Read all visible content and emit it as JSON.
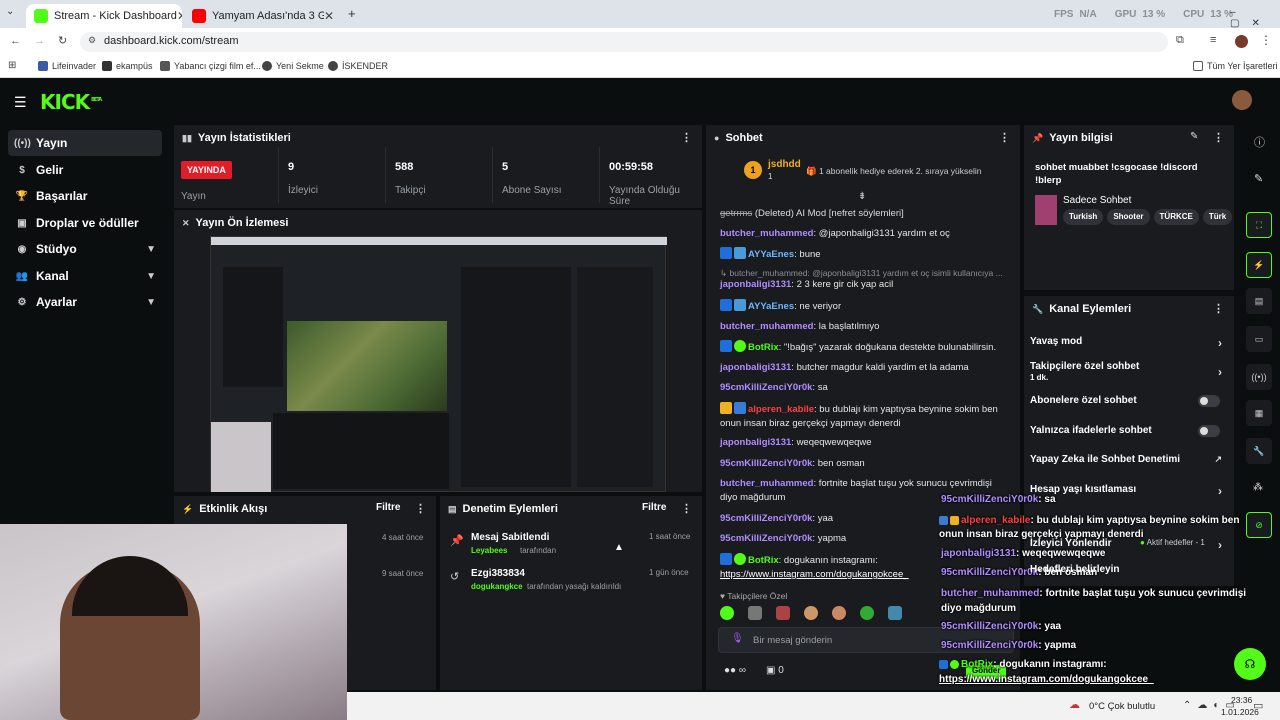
{
  "browser": {
    "tabs": [
      {
        "title": "Stream - Kick Dashboard",
        "active": true
      },
      {
        "title": "Yamyam Adası'nda 3 Günlük Ha",
        "active": false
      }
    ],
    "url": "dashboard.kick.com/stream",
    "perf": {
      "fps_label": "FPS",
      "fps_value": "N/A",
      "gpu_label": "GPU",
      "gpu_value": "13 %",
      "cpu_label": "CPU",
      "cpu_value": "13 %"
    },
    "bookmarks": [
      "Lifeinvader",
      "ekampüs",
      "Yabancı çizgi film ef...",
      "Yeni Sekme",
      "İSKENDER"
    ],
    "all_bookmarks": "Tüm Yer İşaretleri"
  },
  "brand": {
    "logo": "KICK",
    "beta": "BETA"
  },
  "sidebar": {
    "items": [
      {
        "label": "Yayın",
        "icon": "broadcast-icon",
        "active": true
      },
      {
        "label": "Gelir",
        "icon": "dollar-icon"
      },
      {
        "label": "Başarılar",
        "icon": "trophy-icon"
      },
      {
        "label": "Droplar ve ödüller",
        "icon": "gift-icon"
      },
      {
        "label": "Stüdyo",
        "icon": "studio-icon",
        "expandable": true
      },
      {
        "label": "Kanal",
        "icon": "people-icon",
        "expandable": true
      },
      {
        "label": "Ayarlar",
        "icon": "gear-icon",
        "expandable": true
      }
    ]
  },
  "stats": {
    "title": "Yayın İstatistikleri",
    "live_badge": "YAYINDA",
    "live_label": "Yayın",
    "items": [
      {
        "value": "9",
        "label": "İzleyici"
      },
      {
        "value": "588",
        "label": "Takipçi"
      },
      {
        "value": "5",
        "label": "Abone Sayısı"
      },
      {
        "value": "00:59:58",
        "label": "Yayında Olduğu Süre"
      }
    ]
  },
  "preview": {
    "title": "Yayın Ön İzlemesi"
  },
  "activity": {
    "title": "Etkinlik Akışı",
    "filter": "Filtre",
    "times": [
      "4 saat önce",
      "9 saat önce"
    ]
  },
  "moderation": {
    "title": "Denetim Eylemleri",
    "filter": "Filtre",
    "entries": [
      {
        "title": "Mesaj Sabitlendi",
        "actor": "Leyabees",
        "suffix": "tarafından",
        "time": "1 saat önce"
      },
      {
        "title": "Ezgi383834",
        "actor": "dogukangkce",
        "suffix": "tarafından yasağı kaldırıldı",
        "time": "1 gün önce"
      }
    ]
  },
  "chat": {
    "title": "Sohbet",
    "top_gifter": {
      "rank": "1",
      "name": "jsdhdd",
      "count": "1"
    },
    "gift_message": "1 abonelik hediye ederek 2. sıraya yükselin",
    "messages": [
      {
        "user": "getrrms",
        "text": "(Deleted) AI Mod [nefret söylemleri]"
      },
      {
        "user": "butcher_muhammed",
        "text": "@japonbaligi3131 yardım et oç"
      },
      {
        "user": "AYYaEnes",
        "text": "bune"
      },
      {
        "user": "butcher_muhammed",
        "text": "@japonbaligi3131 yardım et oç isimli kullanıcıya ..."
      },
      {
        "user": "japonbaligi3131",
        "text": "2 3 kere gir cik yap acil"
      },
      {
        "user": "AYYaEnes",
        "text": "ne veriyor"
      },
      {
        "user": "butcher_muhammed",
        "text": "la başlatılmıyo"
      },
      {
        "user": "BotRix",
        "text": "\"!bağış\" yazarak doğukana destekte bulunabilirsin."
      },
      {
        "user": "japonbaligi3131",
        "text": "butcher magdur kaldi yardim et la adama"
      },
      {
        "user": "95cmKilliZenciY0r0k",
        "text": "sa"
      },
      {
        "user": "alperen_kabile",
        "text": "bu dublajı kim yaptıysa beynine sokim ben onun insan biraz gerçekçi yapmayı denerdi"
      },
      {
        "user": "japonbaligi3131",
        "text": "weqeqwewqeqwe"
      },
      {
        "user": "95cmKilliZenciY0r0k",
        "text": "ben osman"
      },
      {
        "user": "butcher_muhammed",
        "text": "fortnite başlat tuşu yok sunucu çevrimdişi diyo mağdurum"
      },
      {
        "user": "95cmKilliZenciY0r0k",
        "text": "yaa"
      },
      {
        "user": "95cmKilliZenciY0r0k",
        "text": "yapma"
      },
      {
        "user": "BotRix",
        "text": "dogukanın instagramı:"
      }
    ],
    "link": "https://www.instagram.com/dogukangokcee_",
    "followers_only": "Takipçilere Özel",
    "input_placeholder": "Bir mesaj gönderin",
    "send": "Gönder",
    "points_count": "0",
    "infinity": "∞"
  },
  "stream_info": {
    "title": "Yayın bilgisi",
    "stream_title": "sohbet muabbet !csgocase !discord !blerp",
    "category": "Sadece Sohbet",
    "tags": [
      "Turkish",
      "Shooter",
      "TÜRKCE",
      "Türk"
    ]
  },
  "channel_actions": {
    "title": "Kanal Eylemleri",
    "rows": [
      {
        "label": "Yavaş mod",
        "type": "arrow"
      },
      {
        "label": "Takipçilere özel sohbet",
        "sub": "1 dk.",
        "type": "arrow"
      },
      {
        "label": "Abonelere özel sohbet",
        "type": "toggle"
      },
      {
        "label": "Yalnızca ifadelerle sohbet",
        "type": "toggle"
      },
      {
        "label": "Yapay Zeka ile Sohbet Denetimi",
        "type": "external"
      },
      {
        "label": "Hesap yaşı kısıtlaması",
        "type": "arrow"
      },
      {
        "label": "İzleyici Yönlendir",
        "type": "none"
      },
      {
        "label": "Hedefleri belirleyin",
        "type": "arrow",
        "extra": "Aktif hedefler - 1"
      }
    ]
  },
  "overlay_chat": [
    {
      "user": "95cmKilliZenciY0r0k",
      "text": ": sa"
    },
    {
      "user": "alperen_kabile",
      "text": ": bu dublajı kim yaptıysa beynine sokim ben onun insan biraz gerçekçi yapmayı denerdi"
    },
    {
      "user": "japonbaligi3131",
      "text": ": weqeqwewqeqwe"
    },
    {
      "user": "95cmKilliZenciY0r0k",
      "text": ": ben osman"
    },
    {
      "user": "butcher_muhammed",
      "text": ": fortnite başlat tuşu yok sunucu çevrimdişi diyo mağdurum"
    },
    {
      "user": "95cmKilliZenciY0r0k",
      "text": ": yaa"
    },
    {
      "user": "95cmKilliZenciY0r0k",
      "text": ": yapma"
    },
    {
      "user": "BotRix",
      "text": ": dogukanın instagramı:"
    },
    {
      "user": "",
      "text": "https://www.instagram.com/dogukangokcee_"
    }
  ],
  "taskbar": {
    "weather": "0°C  Çok bulutlu",
    "time": "23:36",
    "date": "1.01.2026"
  },
  "colors": {
    "kick_green": "#53fc18",
    "live_red": "#e11d2a",
    "panel": "#191b1f",
    "bg": "#0b0e0f"
  }
}
